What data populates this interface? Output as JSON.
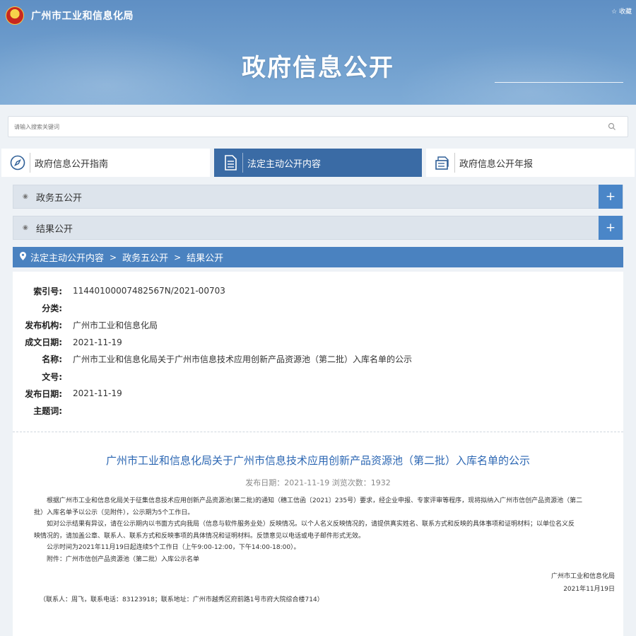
{
  "header": {
    "site_name": "广州市工业和信息化局",
    "favorite_label": "☆ 收藏",
    "banner_title": "政府信息公开"
  },
  "search": {
    "placeholder": "请输入搜索关键词"
  },
  "tabs": [
    {
      "label": "政府信息公开指南",
      "icon": "compass-icon"
    },
    {
      "label": "法定主动公开内容",
      "icon": "document-list-icon"
    },
    {
      "label": "政府信息公开年报",
      "icon": "report-stack-icon"
    }
  ],
  "accordions": [
    {
      "label": "政务五公开",
      "action": "+"
    },
    {
      "label": "结果公开",
      "action": "+"
    }
  ],
  "breadcrumb": {
    "items": [
      "法定主动公开内容",
      "政务五公开",
      "结果公开"
    ],
    "separator": ">"
  },
  "meta": [
    {
      "key": "索引号:",
      "value": "11440100007482567N/2021-00703"
    },
    {
      "key": "分类:",
      "value": ""
    },
    {
      "key": "发布机构:",
      "value": "广州市工业和信息化局"
    },
    {
      "key": "成文日期:",
      "value": "2021-11-19"
    },
    {
      "key": "名称:",
      "value": "广州市工业和信息化局关于广州市信息技术应用创新产品资源池（第二批）入库名单的公示"
    },
    {
      "key": "文号:",
      "value": ""
    },
    {
      "key": "发布日期:",
      "value": "2021-11-19"
    },
    {
      "key": "主题词:",
      "value": ""
    }
  ],
  "document": {
    "title": "广州市工业和信息化局关于广州市信息技术应用创新产品资源池（第二批）入库名单的公示",
    "info": "发布日期：2021-11-19  浏览次数：1932",
    "p1_line1": "根据广州市工业和信息化局关于征集信息技术应用创新产品资源池(第二批)的通知（穗工信函〔2021〕235号）要求，经企业申报、专家评审等程序，现将拟纳入广州市信创产品资源池（第二",
    "p1_line2": "批）入库名单予以公示（见附件），公示期为5个工作日。",
    "p2_line1": "如对公示结果有异议，请在公示期内以书面方式向我局（信息与软件服务业处）反映情况。以个人名义反映情况的，请提供真实姓名、联系方式和反映的具体事项和证明材料；以单位名义反",
    "p2_line2": "映情况的，请加盖公章、联系人、联系方式和反映事项的具体情况和证明材料。反馈意见以电话或电子邮件形式无效。",
    "p3": "公示时间为2021年11月19日起连续5个工作日（上午9:00-12:00，下午14:00-18:00）。",
    "p4": "附件：广州市信创产品资源池（第二批）入库公示名单",
    "signature_org": "广州市工业和信息化局",
    "signature_date": "2021年11月19日",
    "contact": "（联系人：周飞，联系电话：83123918；联系地址：广州市越秀区府前路1号市府大院综合楼714）"
  }
}
